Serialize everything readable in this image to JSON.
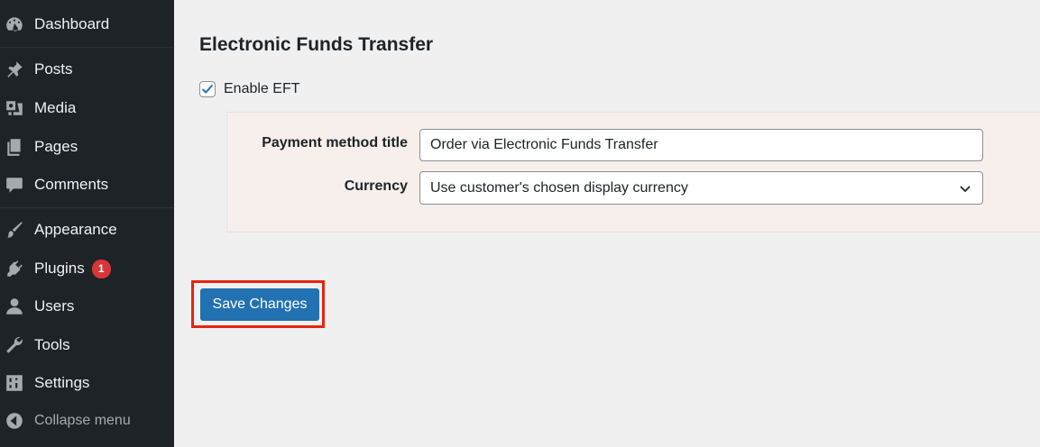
{
  "sidebar": {
    "items": [
      {
        "label": "Dashboard",
        "icon": "dashboard-icon"
      },
      {
        "label": "Posts",
        "icon": "pin-icon"
      },
      {
        "label": "Media",
        "icon": "media-icon"
      },
      {
        "label": "Pages",
        "icon": "pages-icon"
      },
      {
        "label": "Comments",
        "icon": "comment-icon"
      },
      {
        "label": "Appearance",
        "icon": "brush-icon"
      },
      {
        "label": "Plugins",
        "icon": "plug-icon",
        "badge": "1"
      },
      {
        "label": "Users",
        "icon": "user-icon"
      },
      {
        "label": "Tools",
        "icon": "wrench-icon"
      },
      {
        "label": "Settings",
        "icon": "sliders-icon"
      }
    ],
    "collapse_label": "Collapse menu"
  },
  "main": {
    "heading": "Electronic Funds Transfer",
    "enable_label": "Enable EFT",
    "enable_checked": true,
    "fields": {
      "title_label": "Payment method title",
      "title_value": "Order via Electronic Funds Transfer",
      "currency_label": "Currency",
      "currency_value": "Use customer's chosen display currency"
    },
    "save_label": "Save Changes"
  },
  "colors": {
    "sidebar_bg": "#1d2327",
    "primary": "#2271b1",
    "badge": "#d63638",
    "highlight": "#e8240c"
  }
}
